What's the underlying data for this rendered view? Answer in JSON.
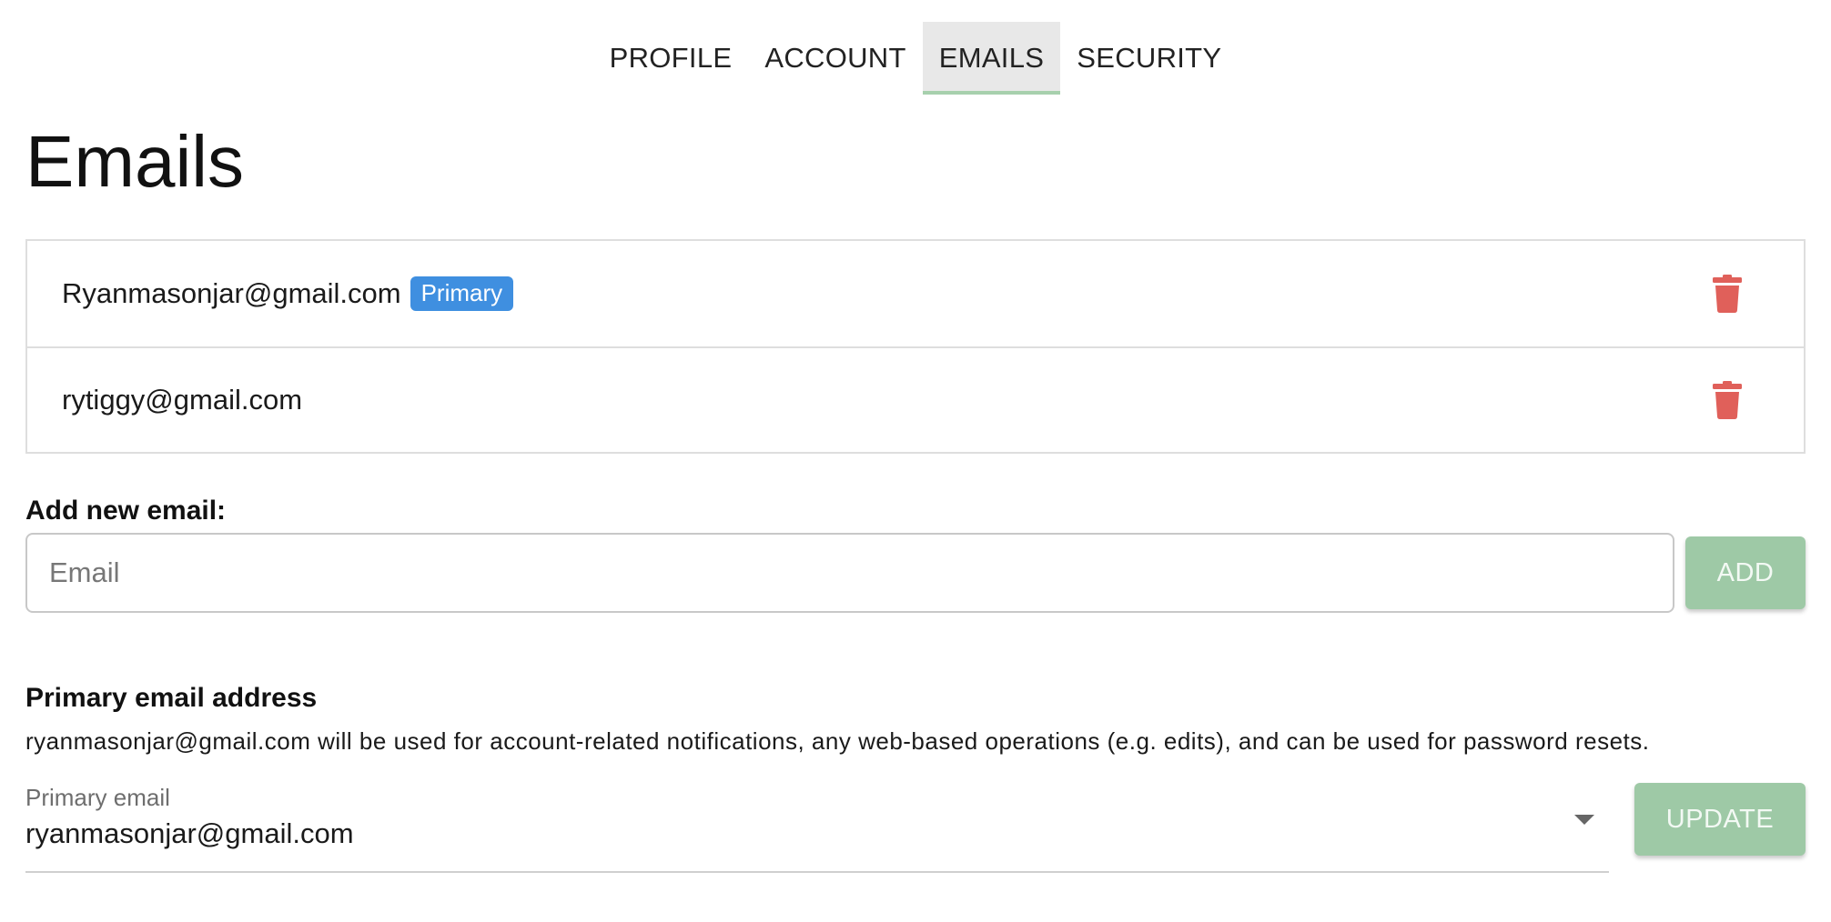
{
  "tabs": [
    {
      "label": "PROFILE",
      "active": false
    },
    {
      "label": "ACCOUNT",
      "active": false
    },
    {
      "label": "EMAILS",
      "active": true
    },
    {
      "label": "SECURITY",
      "active": false
    }
  ],
  "page_title": "Emails",
  "emails": [
    {
      "address": "Ryanmasonjar@gmail.com",
      "badge": "Primary",
      "delete_icon": "trash-icon"
    },
    {
      "address": "rytiggy@gmail.com",
      "badge": null,
      "delete_icon": "trash-icon"
    }
  ],
  "add_email": {
    "label": "Add new email:",
    "placeholder": "Email",
    "value": "",
    "button_label": "ADD"
  },
  "primary_section": {
    "title": "Primary email address",
    "description": "ryanmasonjar@gmail.com will be used for account-related notifications, any web-based operations (e.g. edits), and can be used for password resets.",
    "select_label": "Primary email",
    "select_value": "ryanmasonjar@gmail.com",
    "button_label": "UPDATE"
  },
  "colors": {
    "accent_green": "#9ec9a6",
    "tab_underline": "#a7d0ad",
    "badge_blue": "#3f8fe0",
    "delete_red": "#e0605a"
  }
}
